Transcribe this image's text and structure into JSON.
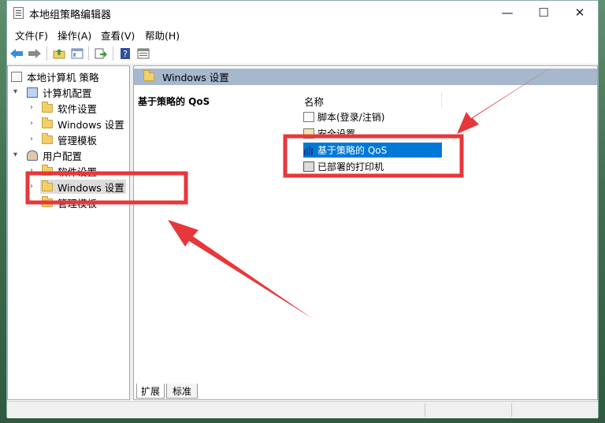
{
  "window": {
    "title": "本地组策略编辑器",
    "controls": {
      "minimize": "—",
      "maximize": "☐",
      "close": "✕"
    }
  },
  "menu": [
    "文件(F)",
    "操作(A)",
    "查看(V)",
    "帮助(H)"
  ],
  "toolbar": {
    "icons": [
      "back-arrow-icon",
      "forward-arrow-icon",
      "up-folder-icon",
      "show-hide-tree-icon",
      "export-list-icon",
      "help-icon",
      "properties-icon"
    ]
  },
  "tree": {
    "root": "本地计算机 策略",
    "computer_config": "计算机配置",
    "computer_children": [
      "软件设置",
      "Windows 设置",
      "管理模板"
    ],
    "user_config": "用户配置",
    "user_children": [
      "软件设置",
      "Windows 设置",
      "管理模板"
    ]
  },
  "right_pane": {
    "header": "Windows 设置",
    "description": "基于策略的 QoS",
    "column_name": "名称",
    "items": [
      "脚本(登录/注销)",
      "安全设置",
      "基于策略的 QoS",
      "已部署的打印机"
    ]
  },
  "tabs": [
    "扩展",
    "标准"
  ],
  "colors": {
    "selection": "#0078d7",
    "header": "#a7b8cc",
    "annotation": "#e8373a"
  }
}
